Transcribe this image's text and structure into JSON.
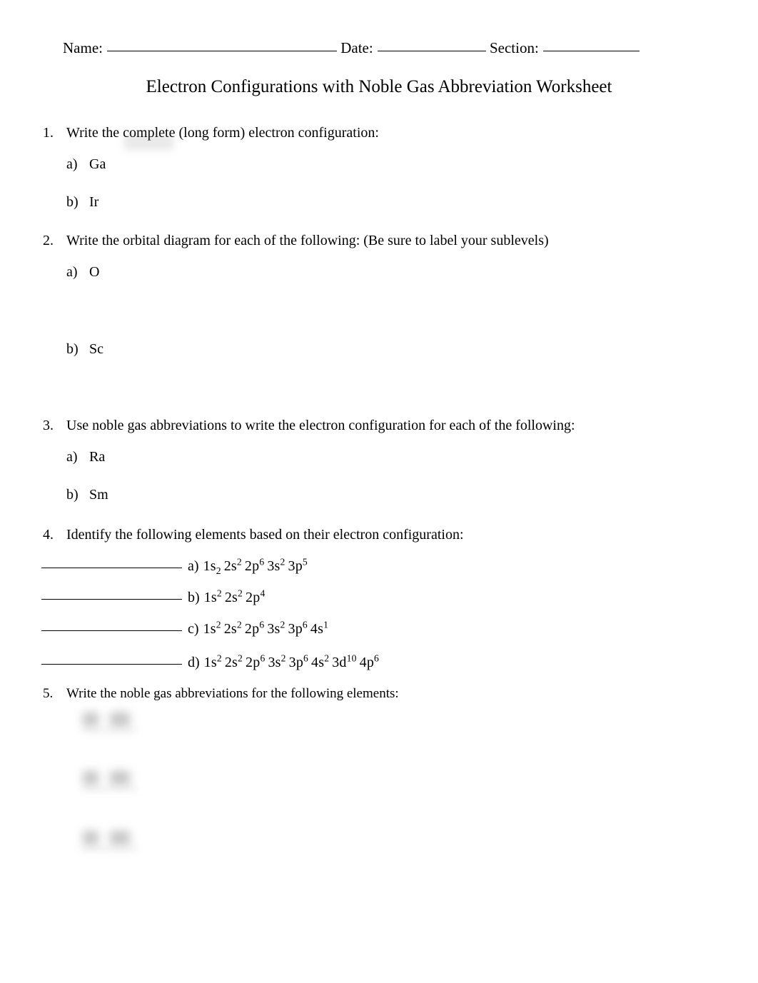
{
  "header": {
    "name_label": "Name:",
    "date_label": "Date:",
    "section_label": "Section:"
  },
  "title": "Electron Configurations with Noble Gas Abbreviation Worksheet",
  "questions": [
    {
      "number": "1.",
      "text_before": "Write the ",
      "highlight_word": "complete",
      "text_after": " (long form) electron configuration:",
      "full_text": "Write the complete (long form) electron configuration:",
      "items": [
        {
          "letter": "a)",
          "label": "Ga"
        },
        {
          "letter": "b)",
          "label": "Ir"
        }
      ]
    },
    {
      "number": "2.",
      "full_text": "Write the orbital diagram   for each of the following:  (Be sure to label your sublevels)",
      "items": [
        {
          "letter": "a)",
          "label": "O"
        },
        {
          "letter": "b)",
          "label": "Sc"
        }
      ]
    },
    {
      "number": "3.",
      "full_text": "Use noble gas abbreviations   to write the electron configuration for each of the following:",
      "items": [
        {
          "letter": "a)",
          "label": "Ra"
        },
        {
          "letter": "b)",
          "label": "Sm"
        }
      ]
    },
    {
      "number": "4.",
      "full_text": "Identify the following elements based on their electron configuration:",
      "blanks": [
        {
          "letter": "a)",
          "orbitals": [
            {
              "shell": "1",
              "sublevel": "s",
              "count": "2",
              "script": "sub"
            },
            {
              "shell": "2",
              "sublevel": "s",
              "count": "2",
              "script": "sup"
            },
            {
              "shell": "2",
              "sublevel": "p",
              "count": "6",
              "script": "sup"
            },
            {
              "shell": "3",
              "sublevel": "s",
              "count": "2",
              "script": "sup"
            },
            {
              "shell": "3",
              "sublevel": "p",
              "count": "5",
              "script": "sup"
            }
          ]
        },
        {
          "letter": "b)",
          "orbitals": [
            {
              "shell": "1",
              "sublevel": "s",
              "count": "2",
              "script": "sup"
            },
            {
              "shell": "2",
              "sublevel": "s",
              "count": "2",
              "script": "sup"
            },
            {
              "shell": "2",
              "sublevel": "p",
              "count": "4",
              "script": "sup"
            }
          ]
        },
        {
          "letter": "c)",
          "orbitals": [
            {
              "shell": "1",
              "sublevel": "s",
              "count": "2",
              "script": "sup"
            },
            {
              "shell": "2",
              "sublevel": "s",
              "count": "2",
              "script": "sup"
            },
            {
              "shell": "2",
              "sublevel": "p",
              "count": "6",
              "script": "sup"
            },
            {
              "shell": "3",
              "sublevel": "s",
              "count": "2",
              "script": "sup"
            },
            {
              "shell": "3",
              "sublevel": "p",
              "count": "6",
              "script": "sup"
            },
            {
              "shell": "4",
              "sublevel": "s",
              "count": "1",
              "script": "sup"
            }
          ]
        },
        {
          "letter": "d)",
          "orbitals": [
            {
              "shell": "1",
              "sublevel": "s",
              "count": "2",
              "script": "sup"
            },
            {
              "shell": "2",
              "sublevel": "s",
              "count": "2",
              "script": "sup"
            },
            {
              "shell": "2",
              "sublevel": "p",
              "count": "6",
              "script": "sup"
            },
            {
              "shell": "3",
              "sublevel": "s",
              "count": "2",
              "script": "sup"
            },
            {
              "shell": "3",
              "sublevel": "p",
              "count": "6",
              "script": "sup"
            },
            {
              "shell": "4",
              "sublevel": "s",
              "count": "2",
              "script": "sup"
            },
            {
              "shell": "3",
              "sublevel": "d",
              "count": "10",
              "script": "sup"
            },
            {
              "shell": "4",
              "sublevel": "p",
              "count": "6",
              "script": "sup"
            }
          ]
        }
      ]
    },
    {
      "number": "5.",
      "full_text": "Write the noble gas abbreviations for the following elements:",
      "redacted_items": 3
    }
  ]
}
